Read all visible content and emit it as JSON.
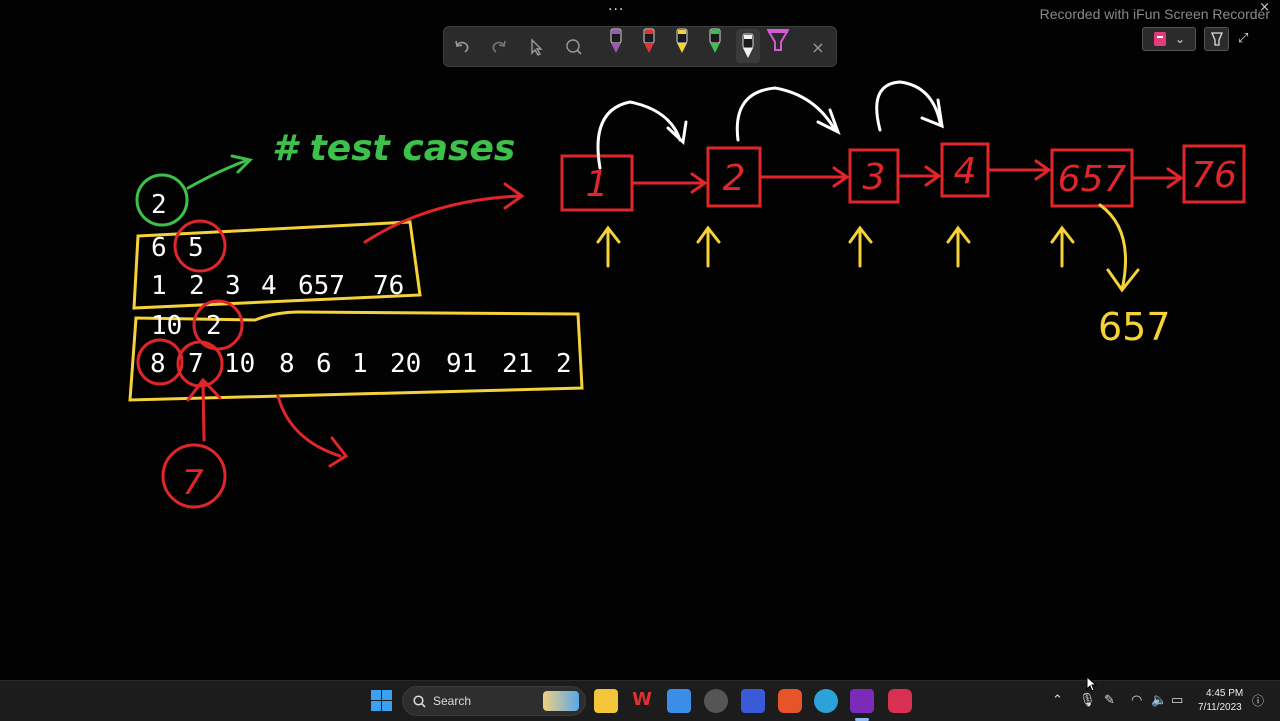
{
  "recorder": {
    "watermark": "Recorded with iFun Screen Recorder"
  },
  "window": {
    "dots": "...",
    "close": "×"
  },
  "ink_toolbar": {
    "undo": "undo-icon",
    "redo": "redo-icon",
    "select": "select-icon",
    "lasso": "lasso-icon",
    "pens": [
      {
        "name": "pen-purple",
        "color": "#9b59b6"
      },
      {
        "name": "pen-red",
        "color": "#e5312f"
      },
      {
        "name": "pen-yellow",
        "color": "#f5d23a"
      },
      {
        "name": "pen-green",
        "color": "#3cc24a"
      },
      {
        "name": "pen-white",
        "color": "#f2f2f2"
      },
      {
        "name": "highlighter-pink",
        "color": "#d35bd8"
      }
    ],
    "close": "×"
  },
  "notes": {
    "testcases_count": "2",
    "testcases_label": "# test cases",
    "case1_header": [
      "6",
      "5"
    ],
    "case1_values": [
      "1",
      "2",
      "3",
      "4",
      "657",
      "76"
    ],
    "case2_header": [
      "10",
      "2"
    ],
    "case2_values": [
      "8",
      "7",
      "10",
      "8",
      "6",
      "1",
      "20",
      "91",
      "21",
      "2"
    ],
    "circled_answer": "7",
    "linked_list_nodes": [
      "1",
      "2",
      "3",
      "4",
      "657",
      "76"
    ],
    "result": "657"
  },
  "colors": {
    "green": "#3cc24a",
    "yellow": "#f5d23a",
    "red": "#e0262a",
    "white": "#ffffff"
  },
  "taskbar": {
    "search_label": "Search",
    "time": "4:45 PM",
    "date": "7/11/2023"
  }
}
